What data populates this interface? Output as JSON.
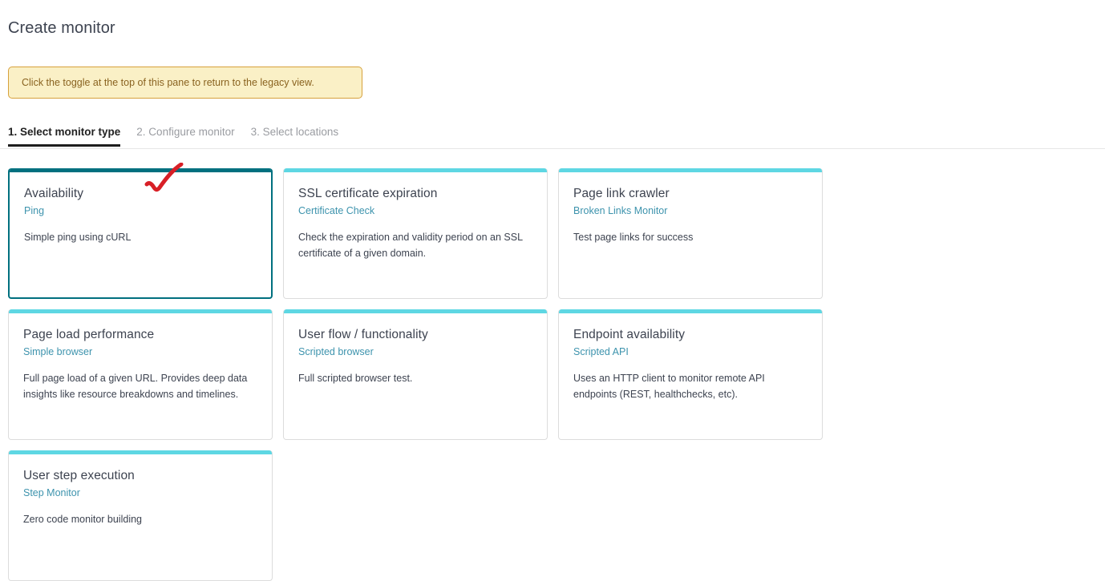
{
  "page": {
    "title": "Create monitor"
  },
  "notice": {
    "text": "Click the toggle at the top of this pane to return to the legacy view.",
    "background_color": "#faf0c6",
    "border_color": "#d7a13c",
    "text_color": "#8a6320"
  },
  "tabs": [
    {
      "label": "1. Select monitor type",
      "active": true
    },
    {
      "label": "2. Configure monitor",
      "active": false
    },
    {
      "label": "3. Select locations",
      "active": false
    }
  ],
  "colors": {
    "selected_card_accent": "#00707f",
    "card_accent": "#5ed7e3",
    "subtitle_link": "#3d93ad",
    "annotation": "#d81f26"
  },
  "cards": [
    {
      "title": "Availability",
      "subtitle": "Ping",
      "description": "Simple ping using cURL",
      "selected": true
    },
    {
      "title": "SSL certificate expiration",
      "subtitle": "Certificate Check",
      "description": "Check the expiration and validity period on an SSL certificate of a given domain.",
      "selected": false
    },
    {
      "title": "Page link crawler",
      "subtitle": "Broken Links Monitor",
      "description": "Test page links for success",
      "selected": false
    },
    {
      "title": "Page load performance",
      "subtitle": "Simple browser",
      "description": "Full page load of a given URL. Provides deep data insights like resource breakdowns and timelines.",
      "selected": false
    },
    {
      "title": "User flow / functionality",
      "subtitle": "Scripted browser",
      "description": "Full scripted browser test.",
      "selected": false
    },
    {
      "title": "Endpoint availability",
      "subtitle": "Scripted API",
      "description": "Uses an HTTP client to monitor remote API endpoints (REST, healthchecks, etc).",
      "selected": false
    },
    {
      "title": "User step execution",
      "subtitle": "Step Monitor",
      "description": "Zero code monitor building",
      "selected": false
    }
  ],
  "annotation": {
    "type": "checkmark",
    "color": "#d81f26"
  }
}
